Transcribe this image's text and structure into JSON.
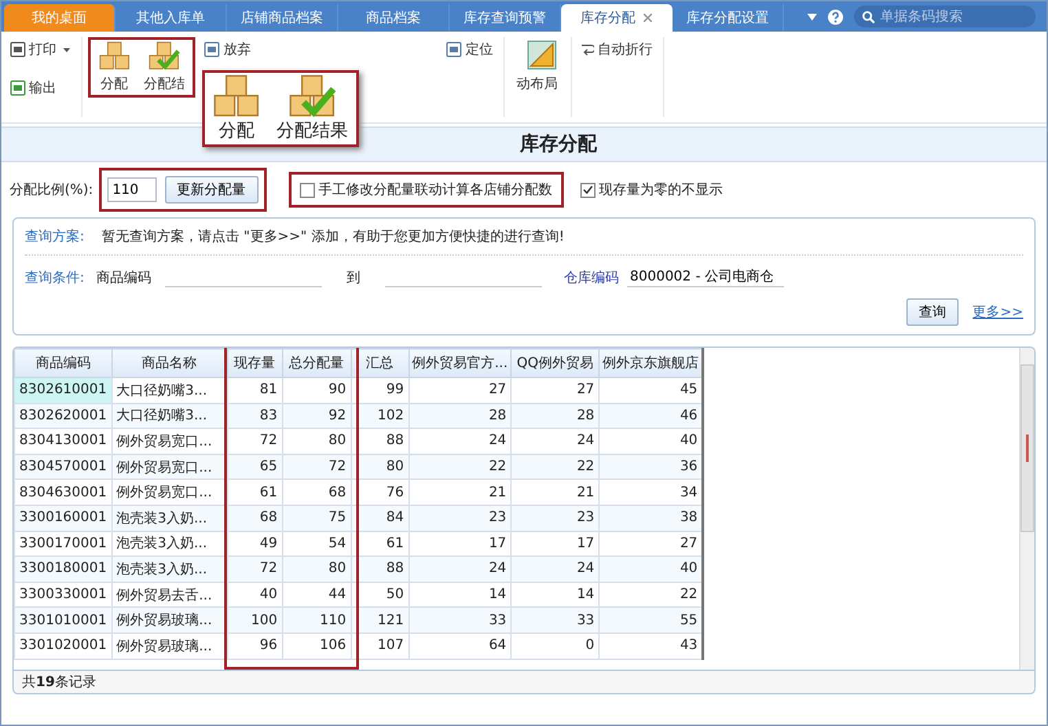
{
  "top_tabs": [
    {
      "label": "我的桌面",
      "selected": false,
      "kind": "home"
    },
    {
      "label": "其他入库单",
      "selected": false,
      "kind": "normal"
    },
    {
      "label": "店铺商品档案",
      "selected": false,
      "kind": "normal"
    },
    {
      "label": "商品档案",
      "selected": false,
      "kind": "normal"
    },
    {
      "label": "库存查询预警",
      "selected": false,
      "kind": "normal"
    },
    {
      "label": "库存分配",
      "selected": true,
      "kind": "normal",
      "closable": true
    },
    {
      "label": "库存分配设置",
      "selected": false,
      "kind": "normal"
    }
  ],
  "search": {
    "placeholder": "单据条码搜索"
  },
  "toolbar": {
    "print": "打印",
    "export": "输出",
    "allocate": "分配",
    "allocate_result": "分配结",
    "discard": "放弃",
    "locate": "定位",
    "auto_layout": "动布局",
    "auto_wrap": "自动折行"
  },
  "callout": {
    "allocate": "分配",
    "allocate_result": "分配结果"
  },
  "page_title": "库存分配",
  "options": {
    "ratio_label": "分配比例(%):",
    "ratio_value": "110",
    "update_button": "更新分配量",
    "checkboxes": [
      {
        "label": "手工修改分配量联动计算各店铺分配数",
        "checked": false
      },
      {
        "label": "现存量为零的不显示",
        "checked": true
      }
    ]
  },
  "query": {
    "scheme_label": "查询方案:",
    "scheme_text": "暂无查询方案，请点击 \"更多>>\" 添加，有助于您更加方便快捷的进行查询!",
    "condition_label": "查询条件:",
    "code_label": "商品编码",
    "to_label": "到",
    "warehouse_label": "仓库编码",
    "warehouse_value": "8000002 - 公司电商仓",
    "query_button": "查询",
    "more_link": "更多>>"
  },
  "table": {
    "columns": [
      "商品编码",
      "商品名称",
      "现存量",
      "总分配量",
      "汇总",
      "例外贸易官方...",
      "QQ例外贸易",
      "例外京东旗舰店"
    ],
    "rows": [
      {
        "selected": true,
        "cells": [
          "8302610001",
          "大口径奶嘴3...",
          "81",
          "90",
          "99",
          "27",
          "27",
          "45"
        ]
      },
      {
        "selected": false,
        "cells": [
          "8302620001",
          "大口径奶嘴3...",
          "83",
          "92",
          "102",
          "28",
          "28",
          "46"
        ]
      },
      {
        "selected": false,
        "cells": [
          "8304130001",
          "例外贸易宽口...",
          "72",
          "80",
          "88",
          "24",
          "24",
          "40"
        ]
      },
      {
        "selected": false,
        "cells": [
          "8304570001",
          "例外贸易宽口...",
          "65",
          "72",
          "80",
          "22",
          "22",
          "36"
        ]
      },
      {
        "selected": false,
        "cells": [
          "8304630001",
          "例外贸易宽口...",
          "61",
          "68",
          "76",
          "21",
          "21",
          "34"
        ]
      },
      {
        "selected": false,
        "cells": [
          "3300160001",
          "泡壳装3入奶...",
          "68",
          "75",
          "84",
          "23",
          "23",
          "38"
        ]
      },
      {
        "selected": false,
        "cells": [
          "3300170001",
          "泡壳装3入奶...",
          "49",
          "54",
          "61",
          "17",
          "17",
          "27"
        ]
      },
      {
        "selected": false,
        "cells": [
          "3300180001",
          "泡壳装3入奶...",
          "72",
          "80",
          "88",
          "24",
          "24",
          "40"
        ]
      },
      {
        "selected": false,
        "cells": [
          "3300330001",
          "例外贸易去舌...",
          "40",
          "44",
          "50",
          "14",
          "14",
          "22"
        ]
      },
      {
        "selected": false,
        "cells": [
          "3301010001",
          "例外贸易玻璃...",
          "100",
          "110",
          "121",
          "33",
          "33",
          "55"
        ]
      },
      {
        "selected": false,
        "cells": [
          "3301020001",
          "例外贸易玻璃...",
          "96",
          "106",
          "107",
          "64",
          "0",
          "43"
        ]
      }
    ]
  },
  "footer": "共**19**条记录"
}
